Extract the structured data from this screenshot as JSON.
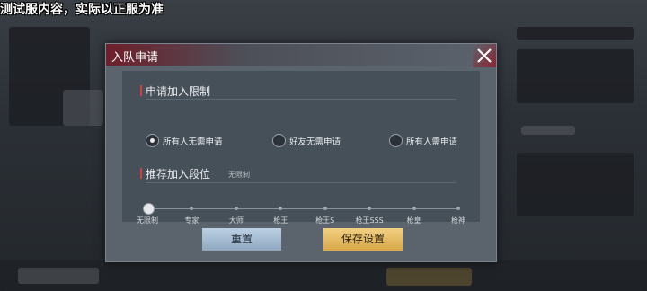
{
  "watermark": "测试服内容，实际以正服为准",
  "dialog": {
    "title": "入队申请",
    "close_icon": "close-icon",
    "section1": {
      "heading": "申请加入限制",
      "options": [
        {
          "label": "所有人无需申请",
          "selected": true
        },
        {
          "label": "好友无需申请",
          "selected": false
        },
        {
          "label": "所有人需申请",
          "selected": false
        }
      ]
    },
    "section2": {
      "heading": "推荐加入段位",
      "current": "无限制",
      "ticks": [
        "无限制",
        "专家",
        "大师",
        "枪王",
        "枪王S",
        "枪王SSS",
        "枪皇",
        "枪神"
      ],
      "selected_index": 0
    },
    "buttons": {
      "reset": "重置",
      "save": "保存设置"
    }
  }
}
